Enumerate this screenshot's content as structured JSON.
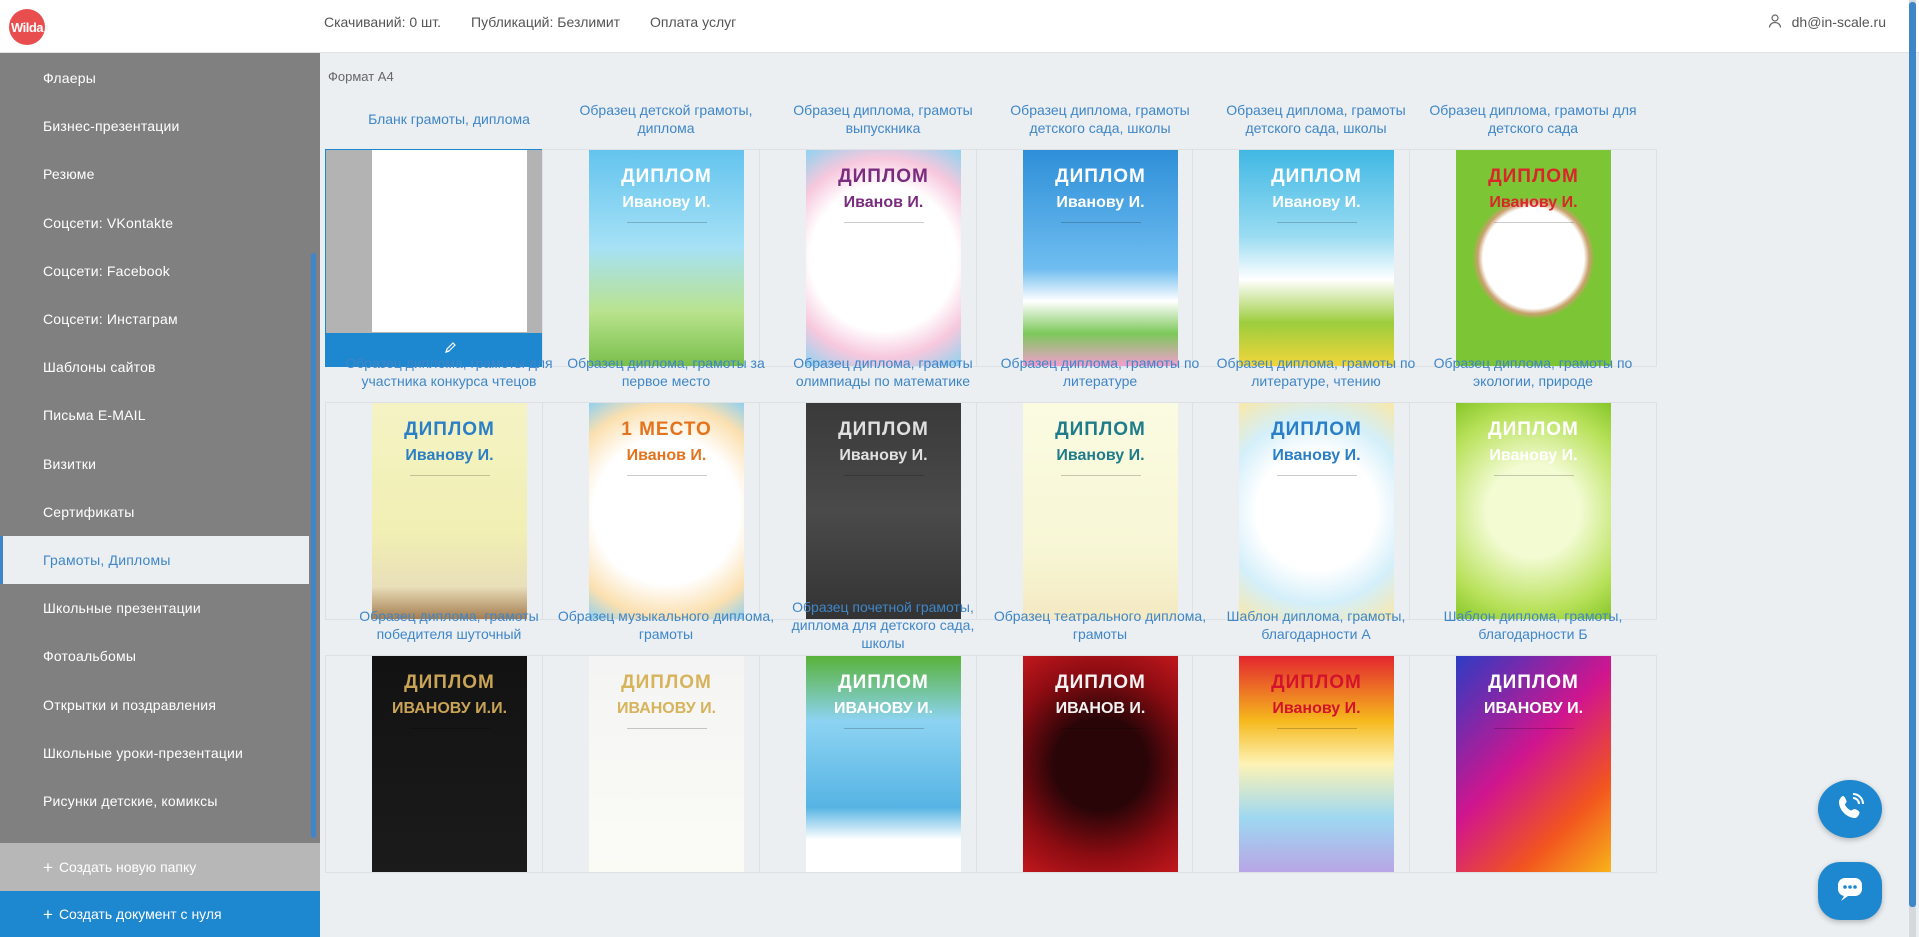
{
  "logo": {
    "text": "Wilda"
  },
  "topnav": {
    "downloads": "Скачиваний: 0 шт.",
    "publications": "Публикаций: Безлимит",
    "payment": "Оплата услуг"
  },
  "user": {
    "email": "dh@in-scale.ru"
  },
  "sidebar": {
    "items": [
      {
        "label": "Флаеры"
      },
      {
        "label": "Бизнес-презентации"
      },
      {
        "label": "Резюме"
      },
      {
        "label": "Соцсети: VKontakte"
      },
      {
        "label": "Соцсети: Facebook"
      },
      {
        "label": "Соцсети: Инстаграм"
      },
      {
        "label": "Шаблоны сайтов"
      },
      {
        "label": "Письма E-MAIL"
      },
      {
        "label": "Визитки"
      },
      {
        "label": "Сертификаты"
      },
      {
        "label": "Грамоты, Дипломы",
        "active": true
      },
      {
        "label": "Школьные презентации"
      },
      {
        "label": "Фотоальбомы"
      },
      {
        "label": "Открытки и поздравления"
      },
      {
        "label": "Школьные уроки-презентации"
      },
      {
        "label": "Рисунки детские, комиксы"
      }
    ],
    "new_folder": "Создать новую папку",
    "new_document": "Создать документ с нуля"
  },
  "main": {
    "section_title": "Формат А4",
    "cards": [
      {
        "title": "Бланк грамоты, диплома",
        "blank": true
      },
      {
        "title": "Образец детской грамоты, диплома",
        "dip": "ДИПЛОМ",
        "name": "Иванову И.",
        "bg": "linear-gradient(#63c4ee, #a6e1f6 45%, #b9e38d 75%, #79bf4b)",
        "fg": "#ffffff"
      },
      {
        "title": "Образец диплома, грамоты выпускника",
        "dip": "ДИПЛОМ",
        "name": "Иванов И.",
        "bg": "radial-gradient(circle, #ffffff 55%, #f7c8dd 75%, #8fd3f0)",
        "fg": "#7a2d7e"
      },
      {
        "title": "Образец диплома, грамоты детского сада, школы",
        "dip": "ДИПЛОМ",
        "name": "Иванову И.",
        "bg": "linear-gradient(#2e8fd8, #6fbdf0 55%, #ffffff 70%, #7cc85a 85%, #f39fd0)",
        "fg": "#ffffff"
      },
      {
        "title": "Образец диплома, грамоты детского сада, школы",
        "dip": "ДИПЛОМ",
        "name": "Иванову И.",
        "bg": "linear-gradient(#40b8e4, #9adcf2 40%, #ffffff 60%, #9ccd3d 80%, #f2d53a)",
        "fg": "#ffffff"
      },
      {
        "title": "Образец диплома, грамоты для детского сада",
        "dip": "ДИПЛОМ",
        "name": "Иванову И.",
        "bg": "radial-gradient(circle, #ffffff 38%, #c9a06d 42%, #7cc534 46%)",
        "fg": "#d8262b"
      },
      {
        "title": "Образец диплома, грамоты для участника конкурса чтецов",
        "dip": "ДИПЛОМ",
        "name": "Иванову И.",
        "bg": "linear-gradient(#f5f3c4, #f1efb3 60%, #e9dfb9 85%, #a57d52)",
        "fg": "#2a7fc6"
      },
      {
        "title": "Образец диплома, грамоты за первое место",
        "dip": "1 МЕСТО",
        "name": "Иванов И.",
        "bg": "radial-gradient(circle, #ffffff 55%, #fbe0b0 80%, #8fd0f0)",
        "fg": "#e4731d"
      },
      {
        "title": "Образец диплома, грамоты олимпиады по математике",
        "dip": "ДИПЛОМ",
        "name": "Иванову И.",
        "bg": "linear-gradient(#3a3a3a, #4a4a4a 50%, #333333)",
        "fg": "#e0e0e0"
      },
      {
        "title": "Образец диплома, грамоты по литературе",
        "dip": "ДИПЛОМ",
        "name": "Иванову И.",
        "bg": "linear-gradient(#fbfbe2, #f7f6d4 70%, #f4e9c2)",
        "fg": "#1f7c8a"
      },
      {
        "title": "Образец диплома, грамоты по литературе, чтению",
        "dip": "ДИПЛОМ",
        "name": "Иванову И.",
        "bg": "radial-gradient(circle, #ffffff 45%, #d4effa 70%, #f9e8a8)",
        "fg": "#2a7fc6"
      },
      {
        "title": "Образец диплома, грамоты по экологии, природе",
        "dip": "ДИПЛОМ",
        "name": "Иванову И.",
        "bg": "radial-gradient(circle, #f2fbd2 35%, #b8e15a 75%, #86c629)",
        "fg": "#ffffff"
      },
      {
        "title": "Образец диплома, грамоты победителя шуточный",
        "dip": "ДИПЛОМ",
        "name": "ИВАНОВУ И.И.",
        "bg": "linear-gradient(#121212, #1b1b1b)",
        "fg": "#c9a456"
      },
      {
        "title": "Образец музыкального диплома, грамоты",
        "dip": "ДИПЛОМ",
        "name": "ИВАНОВУ И.",
        "bg": "linear-gradient(#f4f4f4, #fbfbf6)",
        "fg": "#d7b35b"
      },
      {
        "title": "Образец почетной грамоты, диплома для детского сада, школы",
        "dip": "ДИПЛОМ",
        "name": "ИВАНОВУ И.",
        "bg": "linear-gradient(#58b23a, #8dd3f2 30%, #56b4e4 70%, #ffffff 85%)",
        "fg": "#ffffff"
      },
      {
        "title": "Образец театрального диплома, грамоты",
        "dip": "ДИПЛОМ",
        "name": "ИВАНОВ И.",
        "bg": "radial-gradient(circle, #2a0508 35%, #8d0c12 70%, #c2181c)",
        "fg": "#f2f2f2"
      },
      {
        "title": "Шаблон диплома, грамоты, благодарности А",
        "dip": "ДИПЛОМ",
        "name": "Иванову И.",
        "bg": "linear-gradient(#e3262e, #f6b91d 30%, #fdf3b5 50%, #9ed8f1 75%, #b8a5e5)",
        "fg": "#d3132c"
      },
      {
        "title": "Шаблон диплома, грамоты, благодарности Б",
        "dip": "ДИПЛОМ",
        "name": "ИВАНОВУ И.",
        "bg": "linear-gradient(135deg, #2d3cc4, #d0158e 45%, #f2541f 75%, #f8b31a)",
        "fg": "#ffffff"
      }
    ]
  },
  "colors": {
    "accent": "#1d87cf",
    "link": "#3f86c8",
    "sidebar_bg": "#808080",
    "logo_bg": "#e94e4e"
  },
  "icons": {
    "user": "user-icon",
    "edit": "pencil-icon",
    "phone": "phone-icon",
    "chat": "chat-icon",
    "plus": "plus-icon"
  }
}
